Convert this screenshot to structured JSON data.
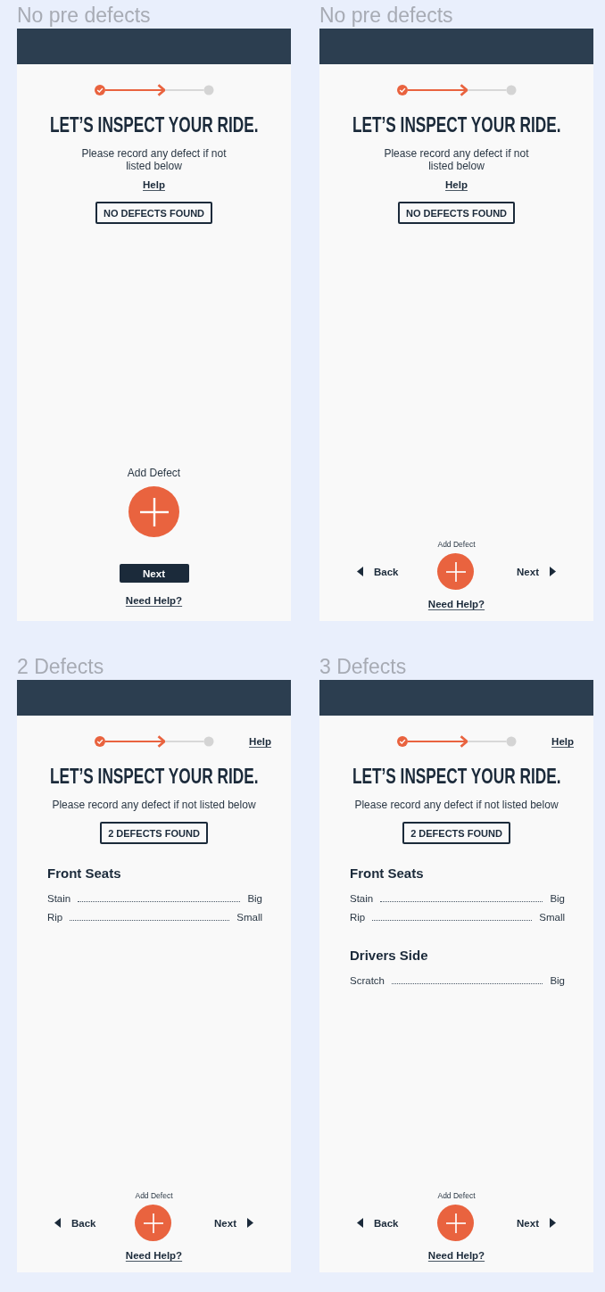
{
  "screens": [
    {
      "label": "No pre defects",
      "steps": [
        {
          "done": true,
          "current": false
        },
        {
          "done": false,
          "current": true
        },
        {
          "done": false,
          "current": false
        }
      ],
      "title": "LET’S INSPECT YOUR RIDE.",
      "subtitle": "Please record any defect if not listed below",
      "help": {
        "label": "Help",
        "kind": "stacked"
      },
      "status_button": "NO DEFECTS FOUND",
      "footer": {
        "kind": "single",
        "add_label": "Add Defect",
        "next": "Next",
        "help_link": "Need Help?"
      }
    },
    {
      "label": "No pre defects",
      "steps": [
        {
          "done": true,
          "current": false
        },
        {
          "done": false,
          "current": true
        },
        {
          "done": false,
          "current": false
        }
      ],
      "title": "LET’S INSPECT YOUR RIDE.",
      "subtitle": "Please record any defect if not listed below",
      "help": {
        "label": "Help",
        "kind": "stacked"
      },
      "status_button": "NO DEFECTS FOUND",
      "footer": {
        "kind": "split",
        "add_label": "Add Defect",
        "back": "Back",
        "next": "Next",
        "help_link": "Need Help?"
      }
    },
    {
      "label": "2 Defects",
      "steps": [
        {
          "done": true,
          "current": false
        },
        {
          "done": false,
          "current": true
        },
        {
          "done": false,
          "current": false
        }
      ],
      "title": "LET’S INSPECT YOUR RIDE.",
      "subtitle": "Please record any defect if not listed below",
      "help": {
        "label": "Help",
        "kind": "top"
      },
      "status_button": "2 DEFECTS FOUND",
      "defect_groups": [
        {
          "name": "Front Seats",
          "items": [
            {
              "name": "Stain",
              "size": "Big"
            },
            {
              "name": "Rip",
              "size": "Small"
            }
          ]
        }
      ],
      "footer": {
        "kind": "split",
        "add_label": "Add Defect",
        "back": "Back",
        "next": "Next",
        "help_link": "Need Help?"
      }
    },
    {
      "label": "3 Defects",
      "steps": [
        {
          "done": true,
          "current": false
        },
        {
          "done": false,
          "current": true
        },
        {
          "done": false,
          "current": false
        }
      ],
      "title": "LET’S INSPECT YOUR RIDE.",
      "subtitle": "Please record any defect if not listed below",
      "help": {
        "label": "Help",
        "kind": "top"
      },
      "status_button": "2 DEFECTS FOUND",
      "defect_groups": [
        {
          "name": "Front Seats",
          "items": [
            {
              "name": "Stain",
              "size": "Big"
            },
            {
              "name": "Rip",
              "size": "Small"
            }
          ]
        },
        {
          "name": "Drivers Side",
          "items": [
            {
              "name": "Scratch",
              "size": "Big"
            }
          ]
        }
      ],
      "footer": {
        "kind": "split",
        "add_label": "Add Defect",
        "back": "Back",
        "next": "Next",
        "help_link": "Need Help?"
      }
    }
  ]
}
